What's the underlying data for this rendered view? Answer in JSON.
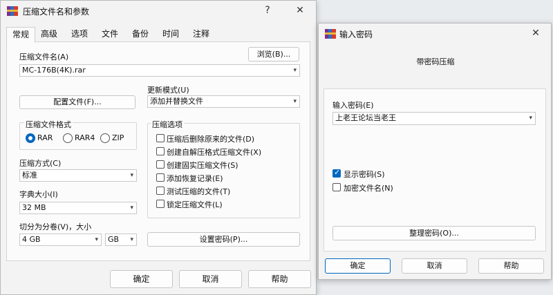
{
  "main_dialog": {
    "title": "压缩文件名和参数",
    "title_help": "?",
    "title_close": "✕",
    "tabs": [
      "常规",
      "高级",
      "选项",
      "文件",
      "备份",
      "时间",
      "注释"
    ],
    "archive_name_label": "压缩文件名(A)",
    "browse_button": "浏览(B)...",
    "archive_name_value": "MC-176B(4K).rar",
    "profile_button": "配置文件(F)...",
    "update_mode_label": "更新模式(U)",
    "update_mode_value": "添加并替换文件",
    "format_group_label": "压缩文件格式",
    "formats": [
      "RAR",
      "RAR4",
      "ZIP"
    ],
    "selected_format": "RAR",
    "options_group_label": "压缩选项",
    "options": [
      {
        "label": "压缩后删除原来的文件(D)",
        "checked": false
      },
      {
        "label": "创建自解压格式压缩文件(X)",
        "checked": false
      },
      {
        "label": "创建固实压缩文件(S)",
        "checked": false
      },
      {
        "label": "添加恢复记录(E)",
        "checked": false
      },
      {
        "label": "测试压缩的文件(T)",
        "checked": false
      },
      {
        "label": "锁定压缩文件(L)",
        "checked": false
      }
    ],
    "method_label": "压缩方式(C)",
    "method_value": "标准",
    "dict_label": "字典大小(I)",
    "dict_value": "32 MB",
    "split_label": "切分为分卷(V)，大小",
    "split_value": "4 GB",
    "split_unit": "GB",
    "set_password_button": "设置密码(P)...",
    "ok_button": "确定",
    "cancel_button": "取消",
    "help_button": "帮助"
  },
  "password_dialog": {
    "title": "输入密码",
    "title_close": "✕",
    "subtitle": "带密码压缩",
    "password_label": "输入密码(E)",
    "password_value": "上老王论坛当老王",
    "show_password_label": "显示密码(S)",
    "show_password_checked": true,
    "encrypt_names_label": "加密文件名(N)",
    "encrypt_names_checked": false,
    "organize_button": "整理密码(O)...",
    "ok_button": "确定",
    "cancel_button": "取消",
    "help_button": "帮助"
  },
  "colors": {
    "accent": "#0067c0",
    "dialog_bg": "#f3f3f3",
    "panel_bg": "#fbfbfb"
  },
  "icons": [
    "winrar-icon",
    "help-icon",
    "close-icon",
    "chevron-down-icon"
  ]
}
